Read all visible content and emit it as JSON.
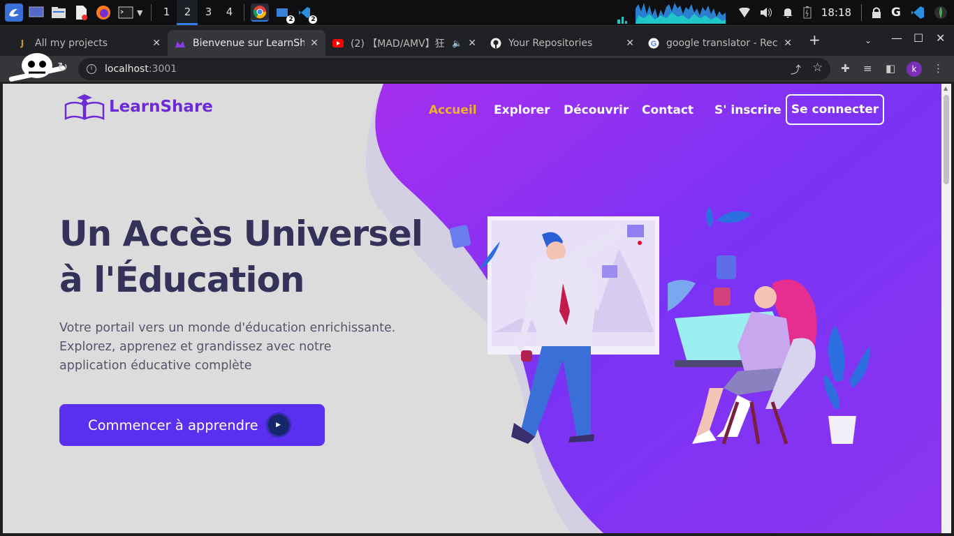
{
  "taskbar": {
    "workspaces": [
      "1",
      "2",
      "3",
      "4"
    ],
    "active_workspace": "2",
    "badges": {
      "chrome_windows": "2",
      "vscode_windows": "2"
    },
    "clock": "18:18",
    "icons": [
      "launcher-icon",
      "desktop-icon",
      "file-manager-icon",
      "document-icon",
      "firefox-icon",
      "terminal-icon",
      "chrome-icon",
      "screenshot-app-icon",
      "vscode-icon",
      "wifi-icon",
      "volume-icon",
      "bell-icon",
      "battery-icon",
      "lock-icon",
      "google-icon",
      "vscode-tray-icon",
      "mongodb-icon"
    ]
  },
  "browser": {
    "tabs": [
      {
        "title": "All my projects",
        "favicon": "jest-icon"
      },
      {
        "title": "Bienvenue sur LearnShare",
        "favicon": "learnshare-icon",
        "active": true
      },
      {
        "title": "(2) 【MAD/AMV】狂",
        "favicon": "youtube-icon",
        "audio": true
      },
      {
        "title": "Your Repositories",
        "favicon": "github-icon"
      },
      {
        "title": "google translator - Rech",
        "favicon": "google-icon"
      }
    ],
    "url_host": "localhost",
    "url_port": ":3001"
  },
  "site": {
    "logo_text": "LearnShare",
    "nav": [
      {
        "label": "Accueil",
        "active": true
      },
      {
        "label": "Explorer"
      },
      {
        "label": "Découvrir"
      },
      {
        "label": "Contact"
      },
      {
        "label": "S' inscrire"
      }
    ],
    "login_label": "Se connecter",
    "hero_title_line1": "Un Accès Universel",
    "hero_title_line2": "à l'Éducation",
    "hero_text": "Votre portail vers un monde d'éducation enrichissante. Explorez, apprenez et grandissez avec notre application éducative complète",
    "cta_label": "Commencer à apprendre",
    "colors": {
      "accent": "#5b2ff0",
      "nav_active": "#e8b22a",
      "title": "#35325a",
      "purple_start": "#9a2df0",
      "purple_end": "#5a3df5"
    }
  }
}
